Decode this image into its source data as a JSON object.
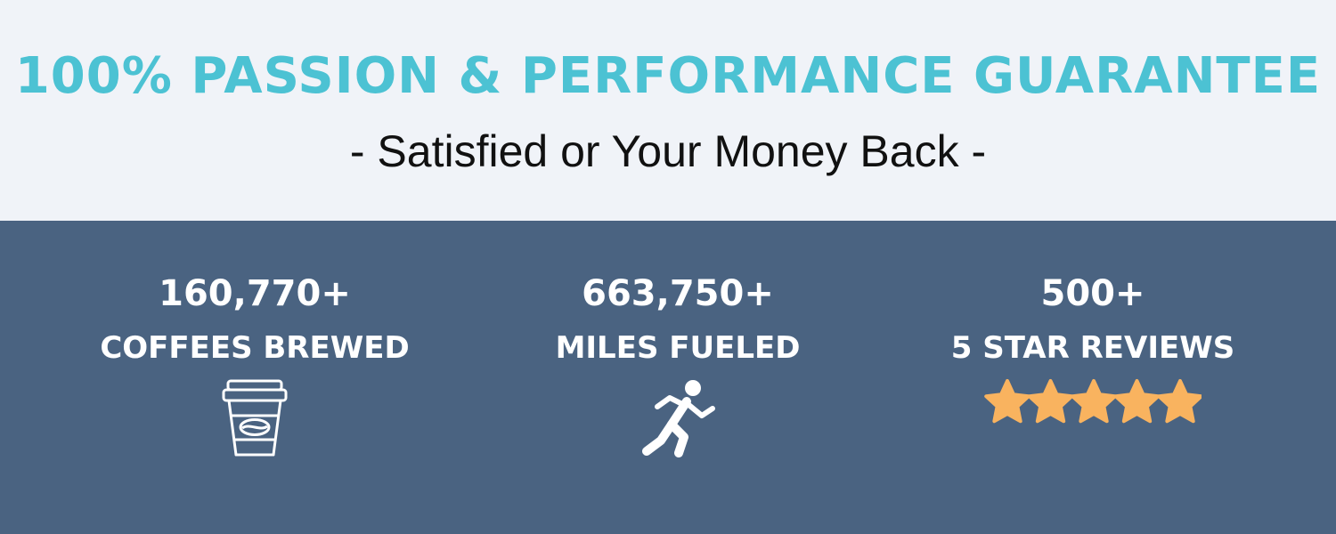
{
  "colors": {
    "top_background": "#f0f3f8",
    "bottom_background": "#4a6381",
    "headline": "#4cc2d3",
    "subheadline": "#111111",
    "stat_text": "#ffffff",
    "star": "#f9b35f"
  },
  "header": {
    "headline": "100% PASSION & PERFORMANCE GUARANTEE",
    "subheadline": "- Satisfied or Your Money Back -"
  },
  "stats": [
    {
      "number": "160,770+",
      "label": "COFFEES BREWED",
      "icon": "coffee-cup-icon"
    },
    {
      "number": "663,750+",
      "label": "MILES FUELED",
      "icon": "runner-icon"
    },
    {
      "number": "500+",
      "label": "5 STAR REVIEWS",
      "icon": "five-stars-icon",
      "rating": 5,
      "rating_max": 5
    }
  ]
}
